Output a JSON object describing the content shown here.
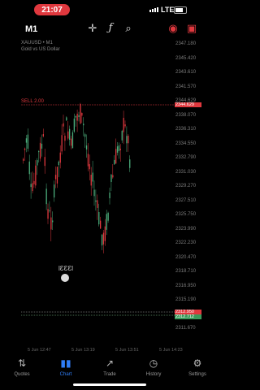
{
  "status": {
    "time": "21:07",
    "network": "LTE"
  },
  "toolbar": {
    "timeframe": "M1",
    "icons": [
      "crosshair-icon",
      "function-icon",
      "objects-icon",
      "trade-icon",
      "settings-flag-icon"
    ]
  },
  "symbol": {
    "title": "XAUUSD • M1",
    "subtitle": "Gold vs US Dollar"
  },
  "chart": {
    "sell_label": "SELL 2.00",
    "price_axis": [
      "2347.180",
      "2345.420",
      "2343.610",
      "2341.570",
      "2344.629",
      "2338.070",
      "2336.310",
      "2334.550",
      "2332.790",
      "2331.030",
      "2329.270",
      "2327.510",
      "2325.750",
      "2323.990",
      "2322.230",
      "2320.470",
      "2318.710",
      "2316.950",
      "2315.190",
      "2313.430",
      "2311.670"
    ],
    "sell_price_tag": "2344.629",
    "current_price_tags": [
      "2312.950",
      "2312.712"
    ],
    "time_axis": [
      "5 Jun 12:47",
      "5 Jun 13:19",
      "5 Jun 13:51",
      "5 Jun 14:23"
    ],
    "watermark": "ƖƐƐƐƖ",
    "colors": {
      "bull": "#4caf7d",
      "bear": "#e0383e",
      "sell_line": "#e0383e",
      "price_line": "#8bd99b"
    }
  },
  "nav": [
    {
      "label": "Quotes",
      "icon": "quotes-icon",
      "active": false
    },
    {
      "label": "Chart",
      "icon": "chart-icon",
      "active": true
    },
    {
      "label": "Trade",
      "icon": "trade-icon",
      "active": false
    },
    {
      "label": "History",
      "icon": "history-icon",
      "active": false
    },
    {
      "label": "Settings",
      "icon": "settings-icon",
      "active": false
    }
  ]
}
